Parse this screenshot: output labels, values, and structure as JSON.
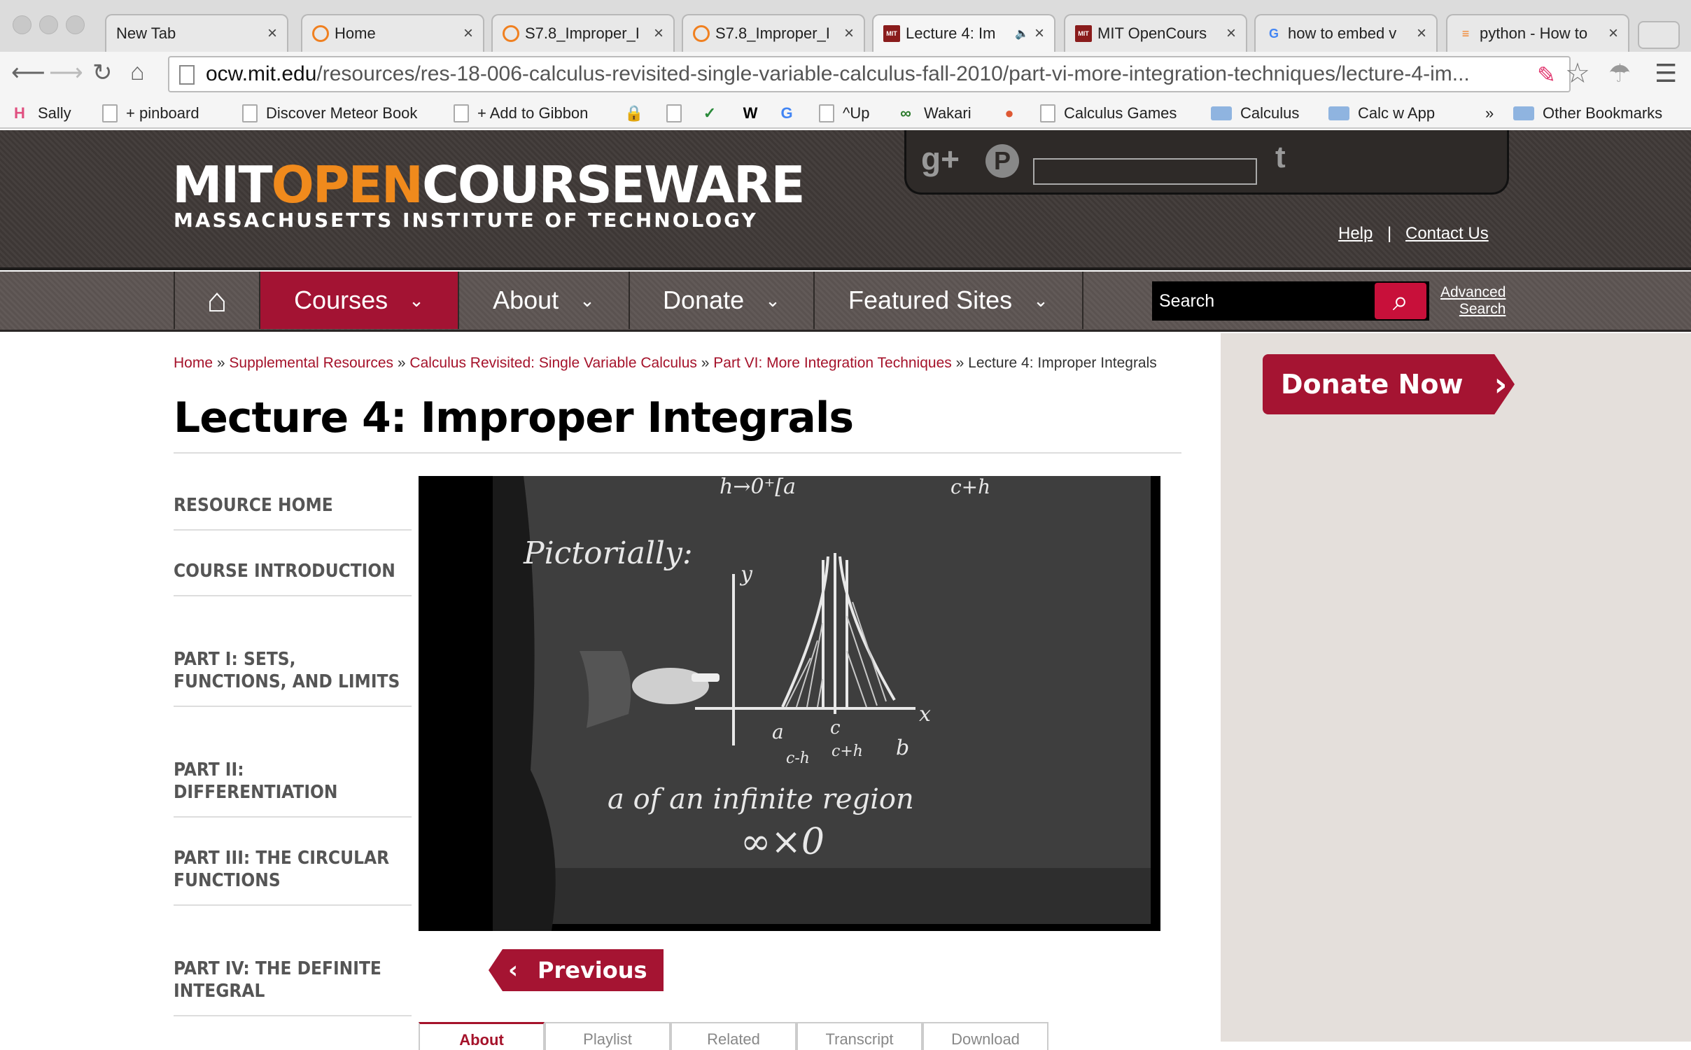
{
  "browser": {
    "tabs": [
      {
        "title": "New Tab",
        "icon": "none"
      },
      {
        "title": "Home",
        "icon": "moodle-icon"
      },
      {
        "title": "S7.8_Improper_I",
        "icon": "moodle-icon"
      },
      {
        "title": "S7.8_Improper_I",
        "icon": "moodle-icon"
      },
      {
        "title": "Lecture 4: Im",
        "icon": "mit-ocw-icon",
        "active": true,
        "audio": true
      },
      {
        "title": "MIT OpenCours",
        "icon": "mit-ocw-icon"
      },
      {
        "title": "how to embed v",
        "icon": "google-icon"
      },
      {
        "title": "python - How to",
        "icon": "stackoverflow-icon"
      }
    ],
    "url_host": "ocw.mit.edu",
    "url_path": "/resources/res-18-006-calculus-revisited-single-variable-calculus-fall-2010/part-vi-more-integration-techniques/lecture-4-im...",
    "bookmarks": [
      {
        "label": "Sally",
        "icon": "sally-icon"
      },
      {
        "label": "+ pinboard",
        "icon": "page-icon"
      },
      {
        "label": "Discover Meteor Book",
        "icon": "page-icon"
      },
      {
        "label": "+ Add to Gibbon",
        "icon": "page-icon"
      },
      {
        "label": "",
        "icon": "lock-icon"
      },
      {
        "label": "",
        "icon": "page-icon"
      },
      {
        "label": "",
        "icon": "leaf-icon"
      },
      {
        "label": "",
        "icon": "wikipedia-icon"
      },
      {
        "label": "",
        "icon": "google-icon"
      },
      {
        "label": "^Up",
        "icon": "page-icon"
      },
      {
        "label": "Wakari",
        "icon": "wakari-icon"
      },
      {
        "label": "",
        "icon": "duckduckgo-icon"
      },
      {
        "label": "Calculus Games",
        "icon": "page-icon"
      },
      {
        "label": "Calculus",
        "icon": "folder-icon"
      },
      {
        "label": "Calc w App",
        "icon": "folder-icon"
      },
      {
        "label": "Other Bookmarks",
        "icon": "folder-icon"
      }
    ],
    "overflow_chevron": "»"
  },
  "site": {
    "logo_part1": "MIT",
    "logo_part2": "OPEN",
    "logo_part3": "COURSEWARE",
    "logo_subtitle": "MASSACHUSETTS INSTITUTE OF TECHNOLOGY",
    "help_link": "Help",
    "separator": "|",
    "contact_link": "Contact Us",
    "nav": [
      {
        "label": "Courses",
        "selected": true
      },
      {
        "label": "About"
      },
      {
        "label": "Donate"
      },
      {
        "label": "Featured Sites"
      }
    ],
    "search_placeholder": "Search",
    "advanced_search_line1": "Advanced",
    "advanced_search_line2": "Search"
  },
  "breadcrumb": {
    "home": "Home",
    "supplemental": "Supplemental Resources",
    "course": "Calculus Revisited: Single Variable Calculus",
    "part": "Part VI: More Integration Techniques",
    "current": "Lecture 4: Improper Integrals",
    "sep": "»"
  },
  "page_title": "Lecture 4: Improper Integrals",
  "sidebar": [
    "RESOURCE HOME",
    "COURSE INTRODUCTION",
    "PART I: SETS, FUNCTIONS, AND LIMITS",
    "PART II: DIFFERENTIATION",
    "PART III: THE CIRCULAR FUNCTIONS",
    "PART IV: THE DEFINITE INTEGRAL"
  ],
  "video": {
    "board_text_pictorially": "Pictorially:",
    "board_text_region": "a of an infinite region",
    "board_text_inf": "∞×0",
    "axis_y": "y",
    "axis_x": "x",
    "label_a": "a",
    "label_b": "b",
    "label_c": "c",
    "label_ch_minus": "c-h",
    "label_ch_plus": "c+h",
    "top_left": "h→0⁺[a",
    "top_right": "c+h"
  },
  "donate_now": "Donate Now",
  "previous": "Previous",
  "video_tabs": [
    "About",
    "Playlist",
    "Related",
    "Transcript",
    "Download"
  ],
  "colors": {
    "accent": "#a5122a",
    "orange": "#f08a1c"
  }
}
